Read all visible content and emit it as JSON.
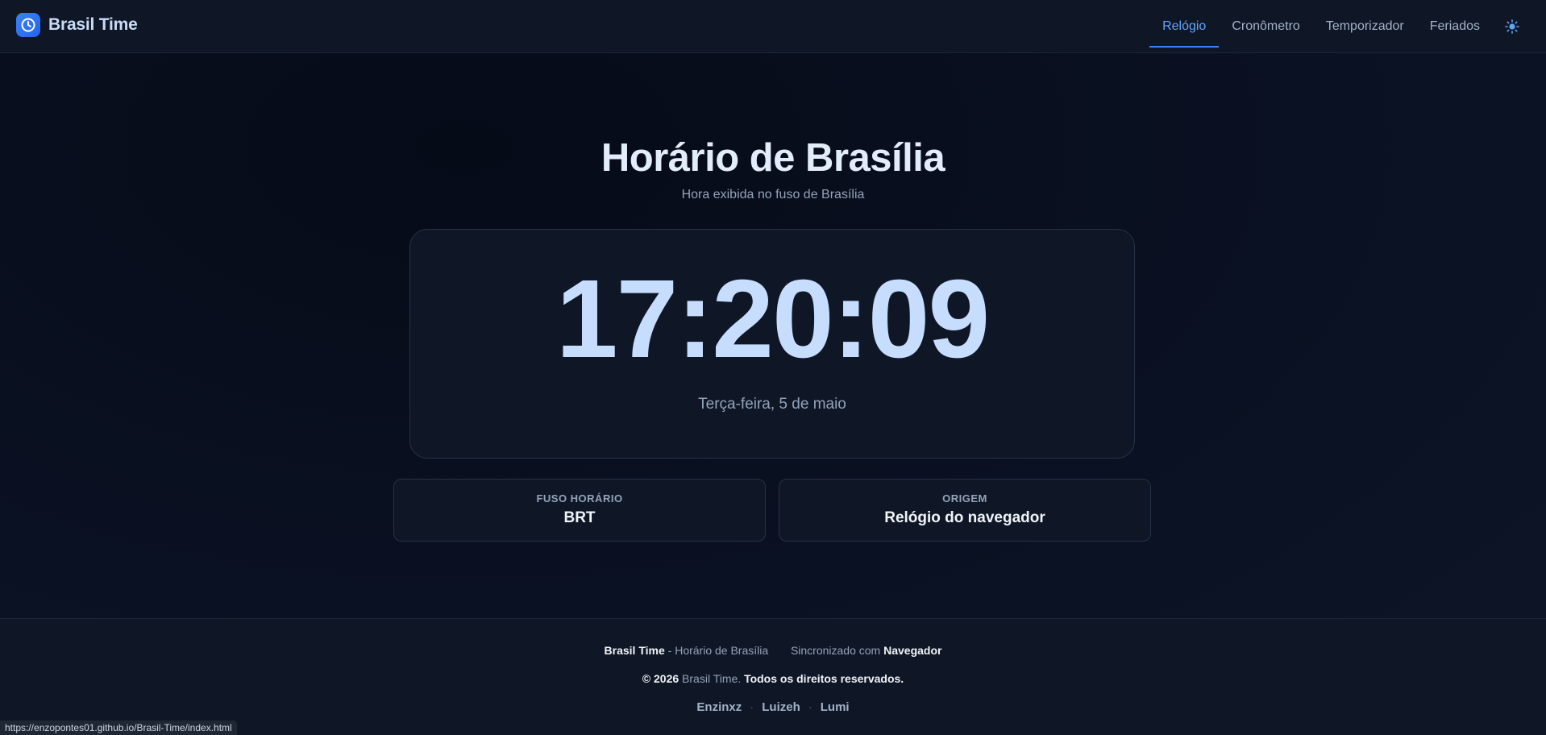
{
  "header": {
    "brand_name": "Brasil Time",
    "nav": [
      {
        "label": "Relógio",
        "active": true
      },
      {
        "label": "Cronômetro",
        "active": false
      },
      {
        "label": "Temporizador",
        "active": false
      },
      {
        "label": "Feriados",
        "active": false
      }
    ],
    "theme_icon": "sun-icon"
  },
  "main": {
    "title": "Horário de Brasília",
    "subtitle": "Hora exibida no fuso de Brasília",
    "time": "17:20:09",
    "date": "Terça-feira, 5 de maio",
    "info_cards": [
      {
        "label": "FUSO HORÁRIO",
        "value": "BRT"
      },
      {
        "label": "ORIGEM",
        "value": "Relógio do navegador"
      }
    ]
  },
  "footer": {
    "brand": "Brasil Time",
    "brand_desc": " - Horário de Brasília",
    "sync_label": "Sincronizado com",
    "sync_value": "Navegador",
    "copyright_prefix": "© 2026",
    "copyright_brand": "Brasil Time.",
    "copyright_suffix": "Todos os direitos reservados.",
    "links": [
      "Enzinxz",
      "Luizeh",
      "Lumi"
    ]
  },
  "status_bar_url": "https://enzopontes01.github.io/Brasil-Time/index.html",
  "colors": {
    "accent": "#3b82f6",
    "clock_text": "#c7ddfe",
    "background": "#0a1122"
  }
}
